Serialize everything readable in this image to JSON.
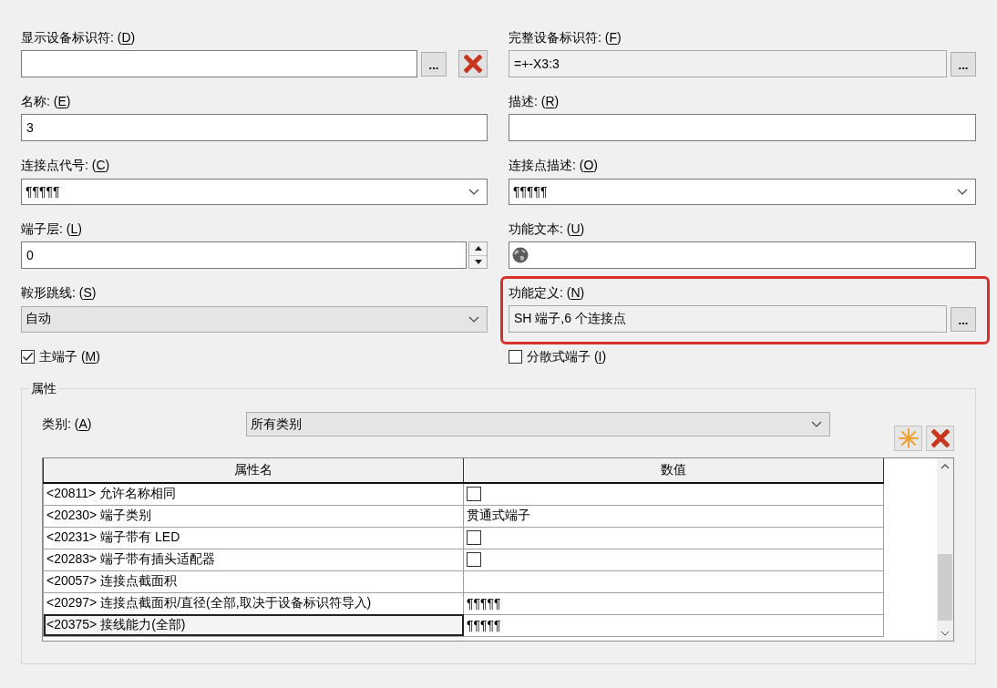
{
  "fields": [
    {
      "label": {
        "text": "显示设备标识符: (",
        "mnemonic": "D",
        "end": ")"
      },
      "kind": "text",
      "readonly": false,
      "highlighted": false,
      "buttons": [
        {
          "kind": "browse",
          "label": "..."
        },
        {
          "kind": "delete"
        }
      ]
    },
    {
      "label": {
        "text": "完整设备标识符: (",
        "mnemonic": "F",
        "end": ")"
      },
      "kind": "text",
      "value": "=+-X3:3",
      "readonly": true,
      "highlighted": false,
      "buttons": [
        {
          "kind": "browse",
          "label": "..."
        }
      ]
    },
    {
      "label": {
        "text": "名称: (",
        "mnemonic": "E",
        "end": ")"
      },
      "kind": "text",
      "value": "3",
      "readonly": false,
      "highlighted": false
    },
    {
      "label": {
        "text": "描述: (",
        "mnemonic": "R",
        "end": ")"
      },
      "kind": "text",
      "readonly": false,
      "highlighted": false
    },
    {
      "label": {
        "text": "连接点代号: (",
        "mnemonic": "C",
        "end": ")"
      },
      "kind": "combo",
      "value": "¶¶¶¶¶",
      "readonly": false,
      "highlighted": false
    },
    {
      "label": {
        "text": "连接点描述: (",
        "mnemonic": "O",
        "end": ")"
      },
      "kind": "combo",
      "value": "¶¶¶¶¶",
      "readonly": false,
      "highlighted": false
    },
    {
      "label": {
        "text": "端子层: (",
        "mnemonic": "L",
        "end": ")"
      },
      "kind": "spin",
      "value": "0",
      "readonly": false,
      "highlighted": false
    },
    {
      "label": {
        "text": "功能文本: (",
        "mnemonic": "U",
        "end": ")"
      },
      "kind": "translatable",
      "readonly": false,
      "highlighted": false
    },
    {
      "label": {
        "text": "鞍形跳线: (",
        "mnemonic": "S",
        "end": ")"
      },
      "kind": "combo",
      "value": "自动",
      "readonly": true,
      "highlighted": false
    },
    {
      "label": {
        "text": "功能定义: (",
        "mnemonic": "N",
        "end": ")"
      },
      "kind": "text",
      "value": "SH 端子,6 个连接点",
      "readonly": true,
      "highlighted": true,
      "buttons": [
        {
          "kind": "browse",
          "label": "..."
        }
      ]
    }
  ],
  "options": [
    {
      "label": {
        "text": "主端子 (",
        "mnemonic": "M",
        "end": ")"
      },
      "checked": true
    },
    {
      "label": {
        "text": "分散式端子 (",
        "mnemonic": "I",
        "end": ")"
      },
      "checked": false
    }
  ],
  "properties": {
    "title": "属性",
    "category": {
      "label": {
        "text": "类别: (",
        "mnemonic": "A",
        "end": ")"
      },
      "value": "所有类别",
      "readonly": true
    },
    "toolbar": [
      {
        "kind": "new"
      },
      {
        "kind": "delete"
      }
    ],
    "table": {
      "columns": [
        "属性名",
        "数值"
      ],
      "rows": [
        {
          "name": "<20811> 允许名称相同",
          "kind": "checkbox",
          "checked": false,
          "selected": false
        },
        {
          "name": "<20230> 端子类别",
          "kind": "text",
          "value": "贯通式端子",
          "selected": false
        },
        {
          "name": "<20231> 端子带有 LED",
          "kind": "checkbox",
          "checked": false,
          "selected": false
        },
        {
          "name": "<20283> 端子带有插头适配器",
          "kind": "checkbox",
          "checked": false,
          "selected": false
        },
        {
          "name": "<20057> 连接点截面积",
          "kind": "text",
          "selected": false
        },
        {
          "name": "<20297> 连接点截面积/直径(全部,取决于设备标识符导入)",
          "kind": "text",
          "value": "¶¶¶¶¶",
          "selected": false
        },
        {
          "name": "<20375> 接线能力(全部)",
          "kind": "text",
          "value": "¶¶¶¶¶",
          "selected": true
        }
      ]
    }
  }
}
